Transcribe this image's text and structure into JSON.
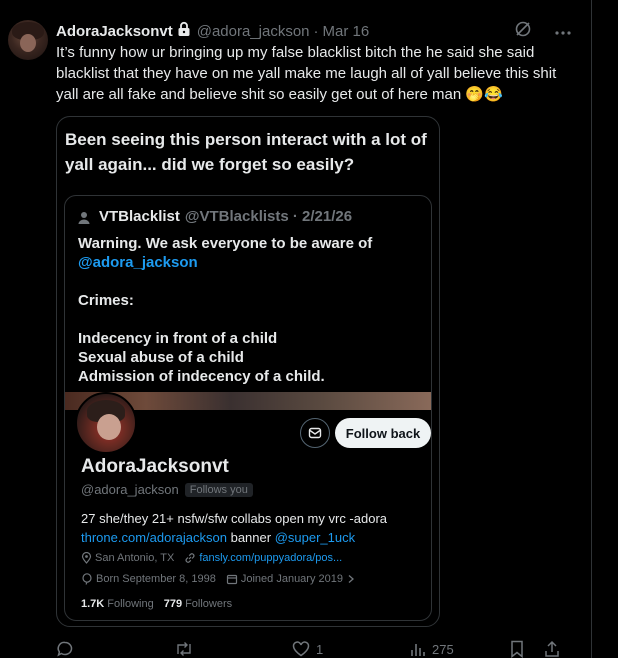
{
  "post": {
    "author_name": "AdoraJacksonvt",
    "author_handle": "@adora_jackson",
    "separator": "·",
    "date": "Mar 16",
    "text": "It’s funny how ur bringing up my false blacklist bitch the he said she said blacklist that they have on me yall make me laugh all of yall believe this shit yall are all fake and believe shit so easily get out of here man 🤭😂"
  },
  "media": {
    "headline": "Been seeing this person interact with a lot of yall again... did we forget so easily?",
    "quote": {
      "name": "VTBlacklist",
      "meta": "@VTBlacklists · 2/21/26",
      "line1": "Warning. We ask everyone to be aware of",
      "mention": "@adora_jackson",
      "crimes_label": "Crimes:",
      "crime1": "Indecency in front of a child",
      "crime2": "Sexual abuse of a child",
      "crime3": "Admission of indecency of a child."
    },
    "profile": {
      "follow_label": "Follow back",
      "name": "AdoraJacksonvt",
      "handle": "@adora_jackson",
      "follows_you": "Follows you",
      "bio_line1": "27 she/they 21+ nsfw/sfw collabs open my vrc -adora",
      "bio_link": "throne.com/adorajackson",
      "bio_mid": " banner ",
      "bio_mention": "@super_1uck",
      "location": "San Antonio, TX",
      "website": "fansly.com/puppyadora/pos...",
      "birthday": "Born September 8, 1998",
      "joined": "Joined January 2019",
      "following_count": "1.7K",
      "following_label": "Following",
      "followers_count": "779",
      "followers_label": "Followers"
    }
  },
  "actions": {
    "likes": "1",
    "views": "275"
  },
  "colors": {
    "background": "#000000",
    "text": "#e7e9ea",
    "muted": "#71767b",
    "link": "#1d9bf0",
    "border": "#2f3336"
  }
}
